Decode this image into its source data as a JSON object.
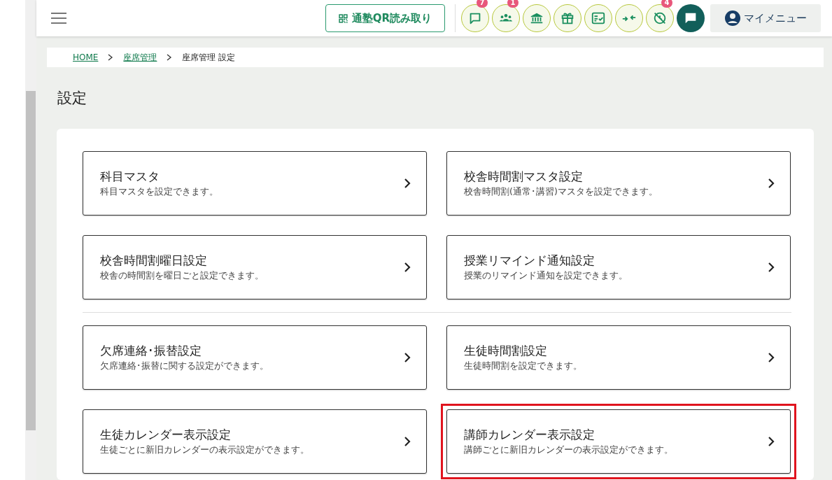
{
  "header": {
    "qr_button": "通塾QR読み取り",
    "icon_buttons": [
      {
        "kind": "chat",
        "badge": "7"
      },
      {
        "kind": "people",
        "badge": "1"
      },
      {
        "kind": "building"
      },
      {
        "kind": "gift"
      },
      {
        "kind": "checklist"
      },
      {
        "kind": "merge"
      },
      {
        "kind": "clock-off",
        "badge": "4"
      }
    ],
    "my_menu": "マイメニュー"
  },
  "breadcrumb": [
    {
      "label": "HOME",
      "link": true
    },
    {
      "label": "座席管理",
      "link": true
    },
    {
      "label": "座席管理 設定",
      "link": false
    }
  ],
  "page_title": "設定",
  "sections": [
    {
      "items": [
        {
          "title": "科目マスタ",
          "description": "科目マスタを設定できます。",
          "highlighted": false
        },
        {
          "title": "校舎時間割マスタ設定",
          "description": "校舎時間割(通常･講習)マスタを設定できます。",
          "highlighted": false
        },
        {
          "title": "校舎時間割曜日設定",
          "description": "校舎の時間割を曜日ごと設定できます。",
          "highlighted": false
        },
        {
          "title": "授業リマインド通知設定",
          "description": "授業のリマインド通知を設定できます。",
          "highlighted": false
        }
      ]
    },
    {
      "items": [
        {
          "title": "欠席連絡･振替設定",
          "description": "欠席連絡･振替に関する設定ができます。",
          "highlighted": false
        },
        {
          "title": "生徒時間割設定",
          "description": "生徒時間割を設定できます。",
          "highlighted": false
        },
        {
          "title": "生徒カレンダー表示設定",
          "description": "生徒ごとに新旧カレンダーの表示設定ができます。",
          "highlighted": false
        },
        {
          "title": "講師カレンダー表示設定",
          "description": "講師ごとに新旧カレンダーの表示設定ができます。",
          "highlighted": true
        }
      ]
    }
  ]
}
